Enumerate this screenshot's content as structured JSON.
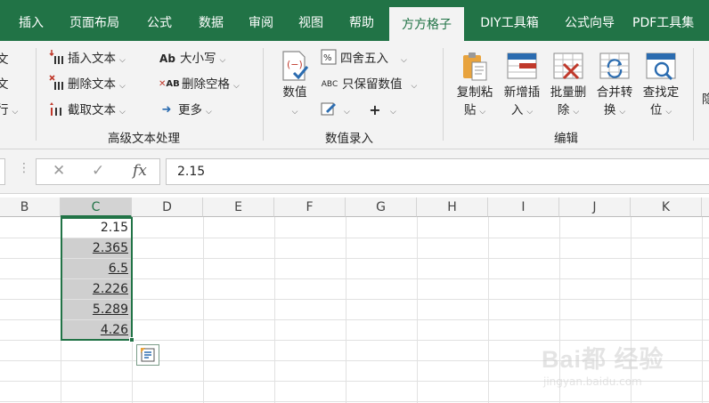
{
  "tabs": [
    {
      "label": "插入",
      "active": false
    },
    {
      "label": "页面布局",
      "active": false
    },
    {
      "label": "公式",
      "active": false
    },
    {
      "label": "数据",
      "active": false
    },
    {
      "label": "审阅",
      "active": false
    },
    {
      "label": "视图",
      "active": false
    },
    {
      "label": "帮助",
      "active": false
    },
    {
      "label": "方方格子",
      "active": true
    },
    {
      "label": "DIY工具箱",
      "active": false
    },
    {
      "label": "公式向导",
      "active": false
    },
    {
      "label": "PDF工具集",
      "active": false
    }
  ],
  "ribbon": {
    "left_partial": [
      "文",
      "文",
      "行"
    ],
    "text_group": {
      "label": "高级文本处理",
      "items": [
        {
          "label": "插入文本",
          "icon": "insert-text-icon"
        },
        {
          "label": "删除文本",
          "icon": "delete-text-icon"
        },
        {
          "label": "截取文本",
          "icon": "extract-text-icon"
        },
        {
          "label": "大小写",
          "icon": "case-icon"
        },
        {
          "label": "删除空格",
          "icon": "delete-space-icon"
        },
        {
          "label": "更多",
          "icon": "arrow-right-icon"
        }
      ]
    },
    "value_group": {
      "label": "数值录入",
      "big_button": {
        "label": "数值",
        "icon": "number-icon"
      },
      "items": [
        {
          "label": "四舍五入",
          "icon": "round-icon"
        },
        {
          "label": "只保留数值",
          "icon": "keep-value-icon"
        },
        {
          "label": "",
          "icon": "edit-icon"
        },
        {
          "label": "",
          "icon": "plus-icon"
        }
      ]
    },
    "edit_group": {
      "label": "编辑",
      "buttons": [
        {
          "line1": "复制粘",
          "line2": "贴",
          "icon": "copy-paste-icon"
        },
        {
          "line1": "新增插",
          "line2": "入",
          "icon": "insert-row-icon"
        },
        {
          "line1": "批量删",
          "line2": "除",
          "icon": "batch-delete-icon"
        },
        {
          "line1": "合并转",
          "line2": "换",
          "icon": "merge-convert-icon"
        },
        {
          "line1": "查找定",
          "line2": "位",
          "icon": "find-locate-icon"
        }
      ],
      "partial_right": "隐"
    }
  },
  "formula_bar": {
    "value": "2.15",
    "cancel_icon": "✕",
    "enter_icon": "✓",
    "fx_label": "fx"
  },
  "columns": [
    "B",
    "C",
    "D",
    "E",
    "F",
    "G",
    "H",
    "I",
    "J",
    "K"
  ],
  "selected_column": "C",
  "cells_c": [
    {
      "value": "2.15",
      "shaded": false
    },
    {
      "value": "2.365",
      "shaded": true
    },
    {
      "value": "6.5",
      "shaded": true
    },
    {
      "value": "2.226",
      "shaded": true
    },
    {
      "value": "5.289",
      "shaded": true
    },
    {
      "value": "4.26",
      "shaded": true
    }
  ],
  "colors": {
    "accent": "#217346",
    "shaded": "#cfcfcf"
  },
  "watermark": {
    "main": "Bai都 经验",
    "sub": "jingyan.baidu.com"
  }
}
